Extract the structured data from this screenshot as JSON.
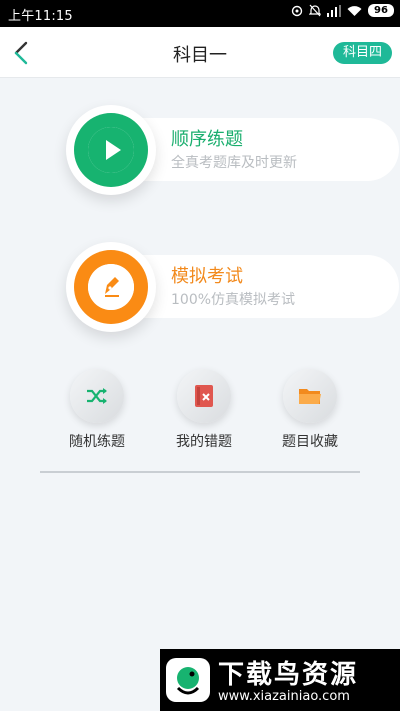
{
  "status_bar": {
    "time": "上午11:15",
    "battery": "96"
  },
  "header": {
    "title": "科目一",
    "subject_switch": "科目四"
  },
  "cards": [
    {
      "title": "顺序练题",
      "subtitle": "全真考题库及时更新"
    },
    {
      "title": "模拟考试",
      "subtitle": "100%仿真模拟考试"
    }
  ],
  "quick_actions": [
    {
      "label": "随机练题"
    },
    {
      "label": "我的错题"
    },
    {
      "label": "题目收藏"
    }
  ],
  "watermark": {
    "title": "下载鸟资源",
    "url": "www.xiazainiao.com"
  },
  "colors": {
    "accent_green": "#17b370",
    "accent_orange": "#fa8b14",
    "switch_teal": "#1fb998",
    "wrong_red": "#e0574f"
  }
}
